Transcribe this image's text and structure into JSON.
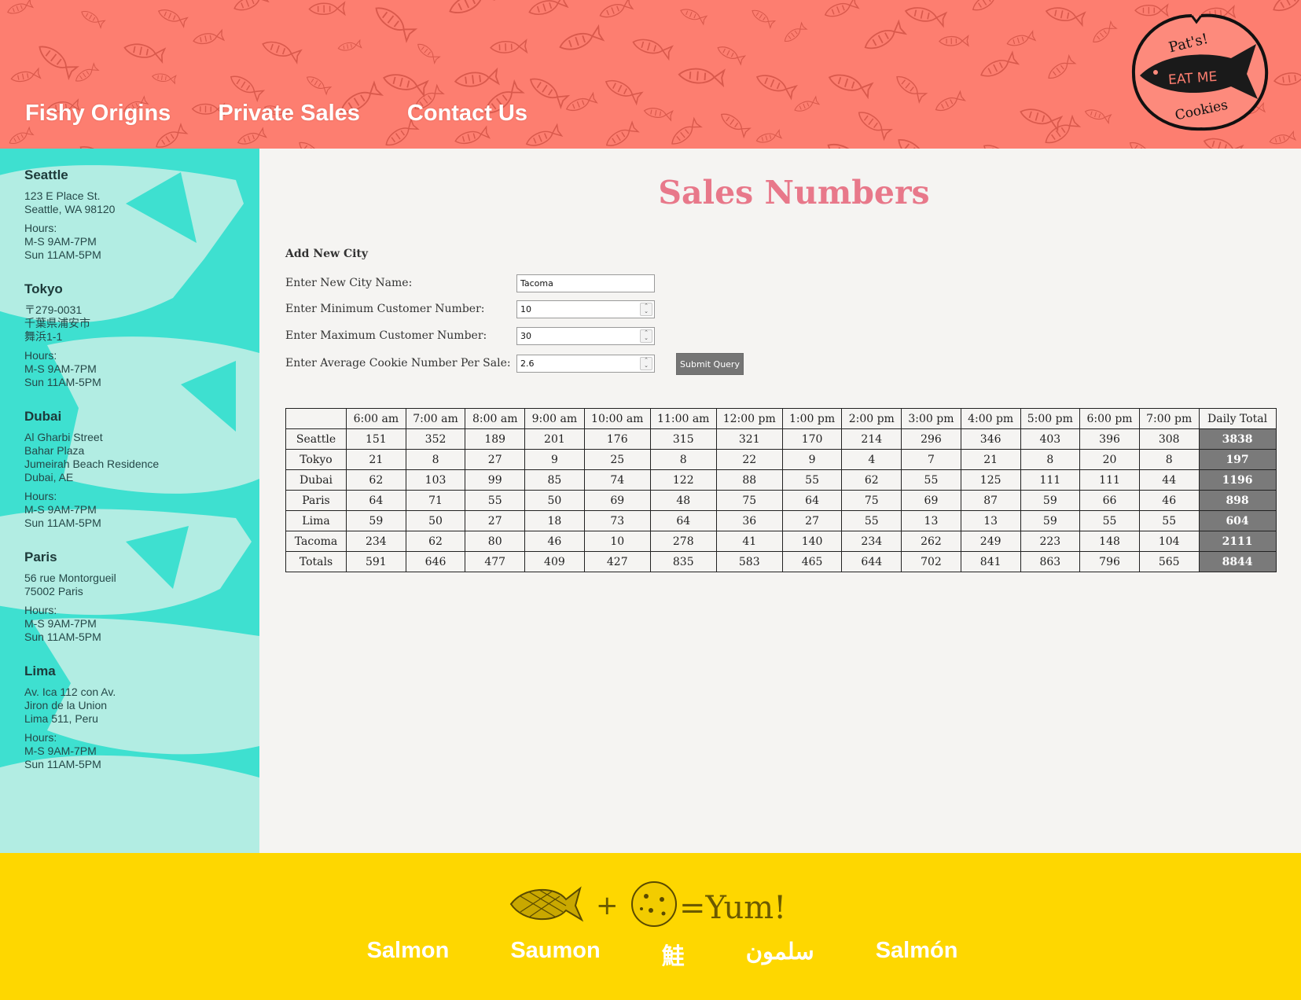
{
  "header": {
    "nav": [
      "Fishy Origins",
      "Private Sales",
      "Contact Us"
    ],
    "logo": {
      "top_text": "Pat's!",
      "middle_text": "EAT ME",
      "bottom_text": "Cookies"
    },
    "colors": {
      "background": "#fd7e70"
    }
  },
  "sidebar": {
    "locations": [
      {
        "city": "Seattle",
        "address": [
          "123 E Place St.",
          "Seattle, WA 98120"
        ],
        "hours": [
          "Hours:",
          "M-S 9AM-7PM",
          "Sun 11AM-5PM"
        ]
      },
      {
        "city": "Tokyo",
        "address": [
          "〒279-0031",
          "千葉県浦安市",
          "舞浜1-1"
        ],
        "hours": [
          "Hours:",
          "M-S 9AM-7PM",
          "Sun 11AM-5PM"
        ]
      },
      {
        "city": "Dubai",
        "address": [
          "Al Gharbi Street",
          "Bahar Plaza",
          "Jumeirah Beach Residence",
          "Dubai, AE"
        ],
        "hours": [
          "Hours:",
          "M-S 9AM-7PM",
          "Sun 11AM-5PM"
        ]
      },
      {
        "city": "Paris",
        "address": [
          "56 rue Montorgueil",
          "75002 Paris"
        ],
        "hours": [
          "Hours:",
          "M-S 9AM-7PM",
          "Sun 11AM-5PM"
        ]
      },
      {
        "city": "Lima",
        "address": [
          "Av. Ica 112 con Av.",
          "Jiron de la Union",
          "Lima 511, Peru"
        ],
        "hours": [
          "Hours:",
          "M-S 9AM-7PM",
          "Sun 11AM-5PM"
        ]
      }
    ],
    "colors": {
      "background": "#3ee0d0",
      "fish": "#b2ede3"
    }
  },
  "main": {
    "title": "Sales Numbers",
    "form": {
      "title": "Add New City",
      "fields": [
        {
          "label": "Enter New City Name:",
          "value": "Tacoma",
          "type": "text"
        },
        {
          "label": "Enter Minimum Customer Number:",
          "value": "10",
          "type": "number"
        },
        {
          "label": "Enter Maximum Customer Number:",
          "value": "30",
          "type": "number"
        },
        {
          "label": "Enter Average Cookie Number Per Sale:",
          "value": "2.6",
          "type": "number"
        }
      ],
      "submit_label": "Submit Query"
    },
    "table": {
      "headers": [
        "",
        "6:00 am",
        "7:00 am",
        "8:00 am",
        "9:00 am",
        "10:00 am",
        "11:00 am",
        "12:00 pm",
        "1:00 pm",
        "2:00 pm",
        "3:00 pm",
        "4:00 pm",
        "5:00 pm",
        "6:00 pm",
        "7:00 pm",
        "Daily Total"
      ],
      "rows": [
        {
          "city": "Seattle",
          "values": [
            "151",
            "352",
            "189",
            "201",
            "176",
            "315",
            "321",
            "170",
            "214",
            "296",
            "346",
            "403",
            "396",
            "308"
          ],
          "total": "3838"
        },
        {
          "city": "Tokyo",
          "values": [
            "21",
            "8",
            "27",
            "9",
            "25",
            "8",
            "22",
            "9",
            "4",
            "7",
            "21",
            "8",
            "20",
            "8"
          ],
          "total": "197"
        },
        {
          "city": "Dubai",
          "values": [
            "62",
            "103",
            "99",
            "85",
            "74",
            "122",
            "88",
            "55",
            "62",
            "55",
            "125",
            "111",
            "111",
            "44"
          ],
          "total": "1196"
        },
        {
          "city": "Paris",
          "values": [
            "64",
            "71",
            "55",
            "50",
            "69",
            "48",
            "75",
            "64",
            "75",
            "69",
            "87",
            "59",
            "66",
            "46"
          ],
          "total": "898"
        },
        {
          "city": "Lima",
          "values": [
            "59",
            "50",
            "27",
            "18",
            "73",
            "64",
            "36",
            "27",
            "55",
            "13",
            "13",
            "59",
            "55",
            "55"
          ],
          "total": "604"
        },
        {
          "city": "Tacoma",
          "values": [
            "234",
            "62",
            "80",
            "46",
            "10",
            "278",
            "41",
            "140",
            "234",
            "262",
            "249",
            "223",
            "148",
            "104"
          ],
          "total": "2111"
        },
        {
          "city": "Totals",
          "values": [
            "591",
            "646",
            "477",
            "409",
            "427",
            "835",
            "583",
            "465",
            "644",
            "702",
            "841",
            "863",
            "796",
            "565"
          ],
          "total": "8844"
        }
      ]
    },
    "colors": {
      "title": "#e8788a",
      "total_cell": "#7a7a7a"
    }
  },
  "footer": {
    "art_text": "=Yum!",
    "words": [
      "Salmon",
      "Saumon",
      "鮭",
      "سلمون",
      "Salmón"
    ],
    "colors": {
      "background": "#fed700"
    }
  }
}
